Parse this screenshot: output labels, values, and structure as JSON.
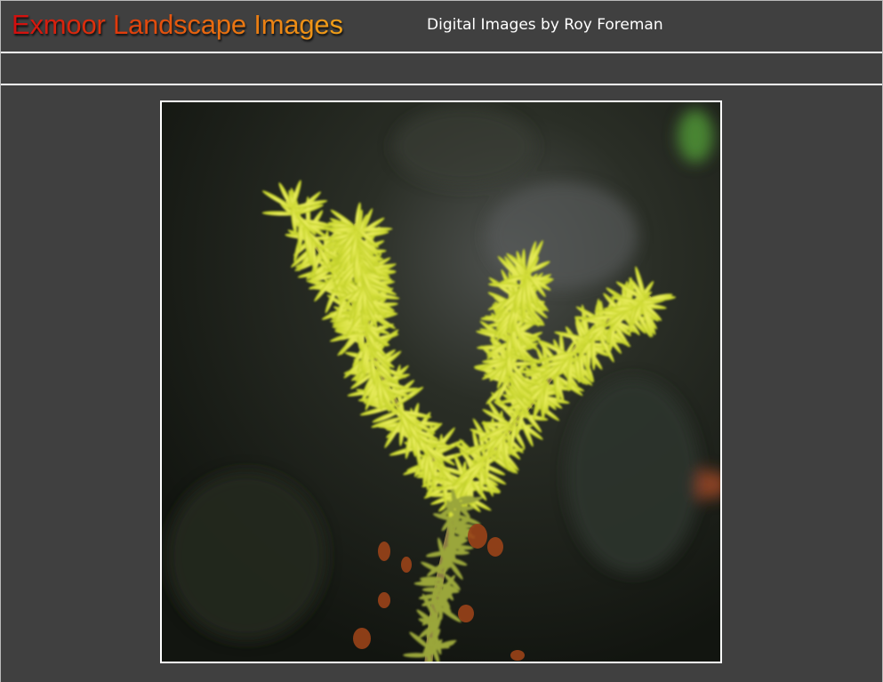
{
  "header": {
    "title": "Exmoor Landscape Images",
    "subtitle": "Digital Images by Roy Foreman"
  },
  "photo": {
    "subject": "yellow-green heather sprig",
    "colors": {
      "background": "#404040",
      "frame": "#ffffff",
      "foliage": "#c9d82e",
      "stem": "#8f7d45"
    }
  }
}
